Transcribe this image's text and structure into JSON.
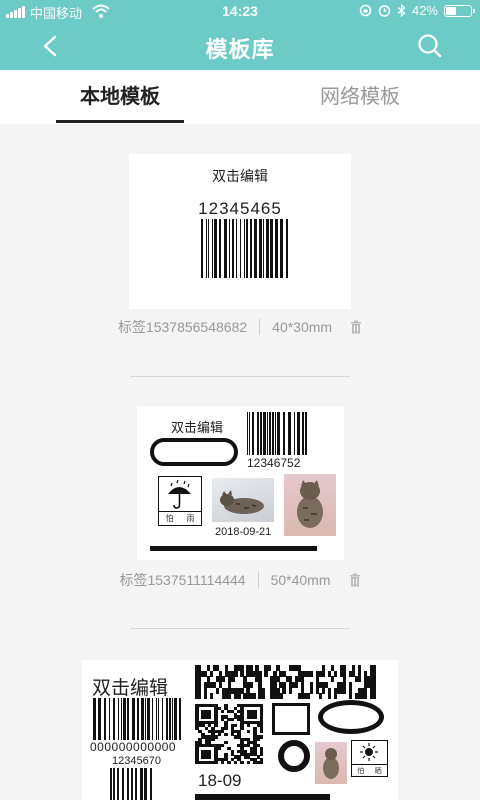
{
  "status_bar": {
    "carrier": "中国移动",
    "time": "14:23",
    "battery_percent": "42%",
    "battery_level": 0.42
  },
  "header": {
    "title": "模板库",
    "back_icon": "chevron-left-icon",
    "search_icon": "search-icon"
  },
  "tabs": [
    {
      "label": "本地模板",
      "active": true
    },
    {
      "label": "网络模板",
      "active": false
    }
  ],
  "templates": [
    {
      "label_name": "标签1537856548682",
      "size": "40*30mm",
      "content": {
        "text": "双击编辑",
        "barcode_number": "12345465"
      }
    },
    {
      "label_name": "标签1537511114444",
      "size": "50*40mm",
      "content": {
        "text": "双击编辑",
        "barcode_number": "12346752",
        "date": "2018-09-21",
        "symbol_caption_left": "怕",
        "symbol_caption_right": "雨"
      }
    },
    {
      "label_name": "",
      "size": "",
      "content": {
        "text": "双击编辑",
        "barcode_number_a": "000000000000",
        "barcode_number_b": "12345670",
        "date_partial": "18-09",
        "symbol_caption_left": "怕",
        "symbol_caption_right": "晒"
      }
    }
  ],
  "colors": {
    "header_bg": "#6ccbc7",
    "page_bg": "#f4f4f4",
    "active_tab": "#222222",
    "inactive_tab": "#999999"
  }
}
